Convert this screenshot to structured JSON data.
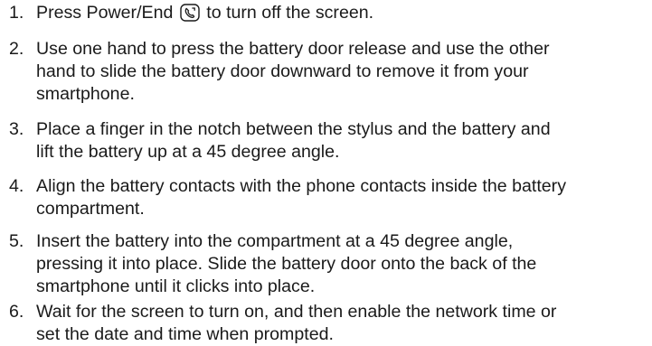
{
  "steps": [
    {
      "number": "1.",
      "text_before_icon": "Press Power/End",
      "icon": "power-end-key-icon",
      "text_after_icon": "to turn off the screen."
    },
    {
      "number": "2.",
      "text": "Use one hand to press the battery door release and use the other\nhand to slide the battery door downward to remove it from your\nsmartphone."
    },
    {
      "number": "3.",
      "text": "Place a finger in the notch between the stylus and the battery and\nlift the battery up at a 45 degree angle."
    },
    {
      "number": "4.",
      "text": "Align the battery contacts with the phone contacts inside the battery\ncompartment."
    },
    {
      "number": "5.",
      "text": "Insert the battery into the compartment at a 45 degree angle,\npressing it into place. Slide the battery door onto the back of the\nsmartphone until it clicks into place."
    },
    {
      "number": "6.",
      "text": "Wait for the screen to turn on, and then enable the network time or\nset the date and time when prompted."
    }
  ]
}
